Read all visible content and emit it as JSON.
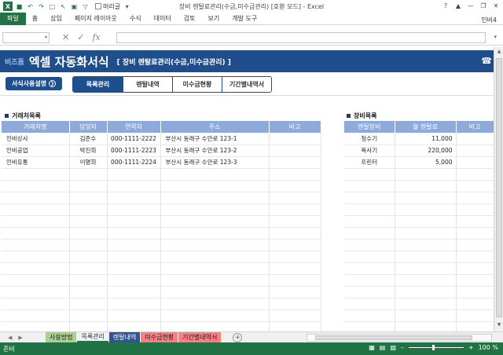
{
  "window": {
    "title": "장비 렌탈료관리(수금,미수금관리) [호환 모드] - Excel",
    "quick_access_checkbox_label": "머리글",
    "controls": [
      "?",
      "—",
      "❐",
      "✕"
    ]
  },
  "ribbon": {
    "file_tab": "파일",
    "tabs": [
      "홈",
      "삽입",
      "페이지 레이아웃",
      "수식",
      "데이터",
      "검토",
      "보기",
      "개발 도구"
    ],
    "user": "인비4"
  },
  "formula_bar": {
    "name_box": "",
    "formula": ""
  },
  "banner": {
    "logo": "비즈폼",
    "title": "엑셀 자동화서식",
    "subtitle": "[ 장비 렌탈료관리(수금,미수금관리) ]"
  },
  "help_button": "서식사용설명",
  "nav_tabs": [
    "목록관리",
    "렌탈내역",
    "미수금현황",
    "기간별내역서"
  ],
  "client_section": {
    "title": "거래처목록",
    "headers": [
      "거래처명",
      "담당자",
      "연락처",
      "주소",
      "비고"
    ],
    "rows": [
      [
        "인비상사",
        "김준수",
        "000-1111-2222",
        "부산시 동래구 수안로 123-1",
        ""
      ],
      [
        "인비공업",
        "박진희",
        "000-1111-2223",
        "부산시 동래구 수안로 123-2",
        ""
      ],
      [
        "인비유통",
        "이명희",
        "000-1111-2224",
        "부산시 동래구 수안로 123-3",
        ""
      ]
    ]
  },
  "equipment_section": {
    "title": "장비목록",
    "headers": [
      "렌탈장비",
      "월 렌탈료",
      "비고"
    ],
    "rows": [
      [
        "청수기",
        "11,000",
        ""
      ],
      [
        "복사기",
        "220,000",
        ""
      ],
      [
        "프린터",
        "5,000",
        ""
      ]
    ]
  },
  "sheet_tabs": [
    "사용방법",
    "목록관리",
    "렌탈내역",
    "미수금현황",
    "기간별내역서"
  ],
  "status": {
    "mode": "준비",
    "zoom": "100 %"
  },
  "colors": {
    "excel_green": "#217346",
    "banner_blue": "#1f4e8c",
    "header_blue": "#8eaadb"
  }
}
